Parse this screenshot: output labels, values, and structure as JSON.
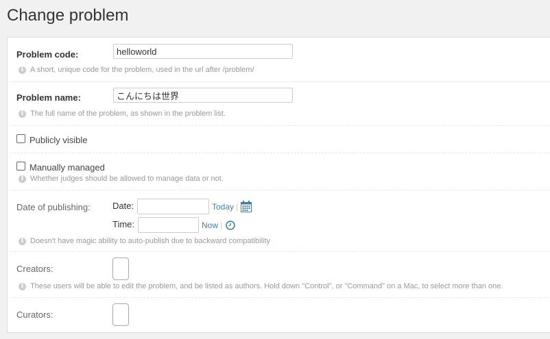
{
  "page": {
    "title": "Change problem"
  },
  "form": {
    "code": {
      "label": "Problem code:",
      "value": "helloworld",
      "help": "A short, unique code for the problem, used in the url after /problem/"
    },
    "name": {
      "label": "Problem name:",
      "value": "こんにちは世界",
      "help": "The full name of the problem, as shown in the problem list."
    },
    "is_public": {
      "label": "Publicly visible",
      "checked": false
    },
    "is_manually_managed": {
      "label": "Manually managed",
      "checked": false,
      "help": "Whether judges should be allowed to manage data or not."
    },
    "date": {
      "label": "Date of publishing:",
      "date_label": "Date:",
      "date_shortcut": "Today",
      "time_label": "Time:",
      "time_shortcut": "Now",
      "separator": "|",
      "help": "Doesn't have magic ability to auto-publish due to backward compatibility"
    },
    "authors": {
      "label": "Creators:",
      "help": "These users will be able to edit the problem, and be listed as authors. Hold down \"Control\", or \"Command\" on a Mac, to select more than one."
    },
    "curators": {
      "label": "Curators:"
    }
  },
  "colors": {
    "link": "#447e9b",
    "help": "#999999",
    "border": "#cccccc"
  },
  "icons": [
    "info-icon",
    "calendar-icon",
    "clock-icon"
  ]
}
